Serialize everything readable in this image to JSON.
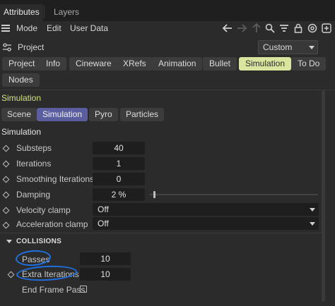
{
  "top_tabs": {
    "attributes": "Attributes",
    "layers": "Layers"
  },
  "menu": {
    "mode": "Mode",
    "edit": "Edit",
    "user_data": "User Data"
  },
  "toolbar_icons": [
    "arrow-left-icon",
    "arrow-right-icon",
    "arrow-up-icon",
    "search-icon",
    "filter-icon",
    "lock-icon",
    "target-icon",
    "add-panel-icon"
  ],
  "project": {
    "label": "Project",
    "preset": "Custom"
  },
  "tabs": {
    "row1": [
      "Project",
      "Info",
      "Cineware",
      "XRefs",
      "Animation",
      "Bullet",
      "Simulation",
      "To Do"
    ],
    "row2": [
      "Nodes"
    ],
    "active": "Simulation"
  },
  "section": {
    "title": "Simulation"
  },
  "subtabs": {
    "items": [
      "Scene",
      "Simulation",
      "Pyro",
      "Particles"
    ],
    "active": "Simulation"
  },
  "group_title": "Simulation",
  "params": {
    "substeps": {
      "label": "Substeps",
      "value": "40"
    },
    "iterations": {
      "label": "Iterations",
      "value": "1"
    },
    "smoothing": {
      "label": "Smoothing Iterations",
      "value": "0"
    },
    "damping": {
      "label": "Damping",
      "value": "2 %",
      "level_percent": 2
    },
    "velocity": {
      "label": "Velocity clamp",
      "value": "Off"
    },
    "acceleration": {
      "label": "Acceleration clamp",
      "value": "Off"
    }
  },
  "collisions": {
    "title": "COLLISIONS",
    "passes": {
      "label": "Passes",
      "value": "10"
    },
    "extra": {
      "label": "Extra Iterations",
      "value": "10"
    },
    "end_frame": {
      "label": "End Frame Pass",
      "checked": false
    }
  },
  "colors": {
    "accent_tab": "#d9e59e",
    "active_subtab": "#5a5e9e",
    "section_title": "#cfe37f",
    "annotation": "#1f6fe0"
  }
}
